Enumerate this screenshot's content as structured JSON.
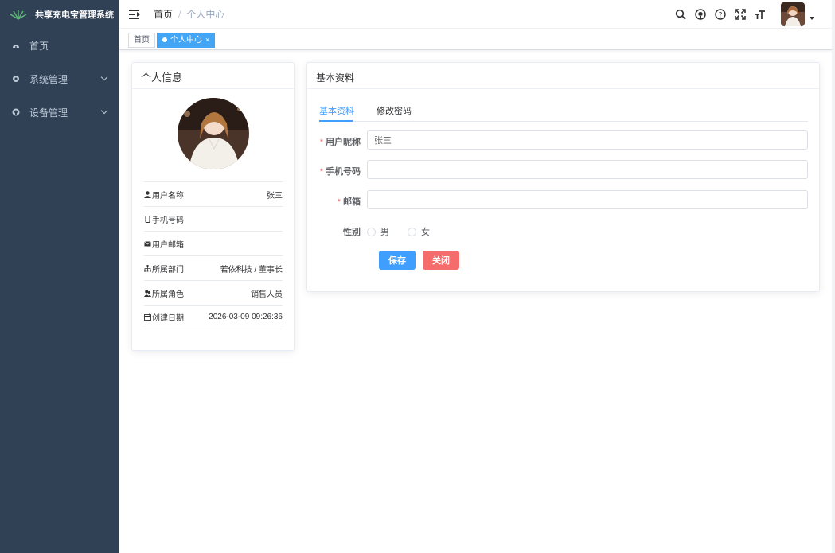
{
  "app": {
    "title": "共享充电宝管理系统",
    "colors": {
      "sidebar_bg": "#304156",
      "accent": "#409eff",
      "danger": "#f56c6c",
      "tag_active": "#409eff"
    }
  },
  "sidebar": {
    "items": [
      {
        "label": "首页",
        "icon": "dashboard-icon",
        "has_arrow": false
      },
      {
        "label": "系统管理",
        "icon": "gear-icon",
        "has_arrow": true
      },
      {
        "label": "设备管理",
        "icon": "github-icon",
        "has_arrow": true
      }
    ]
  },
  "navbar": {
    "breadcrumb": [
      "首页",
      "/",
      "个人中心"
    ],
    "icons": [
      "search-icon",
      "github-icon",
      "help-icon",
      "fullscreen-icon",
      "font-size-icon"
    ]
  },
  "tags": [
    {
      "label": "首页",
      "active": false
    },
    {
      "label": "个人中心",
      "active": true,
      "close": "×"
    }
  ],
  "profile": {
    "title": "个人信息",
    "rows": [
      {
        "icon": "user-icon",
        "label": "用户名称",
        "value": "张三"
      },
      {
        "icon": "phone-icon",
        "label": "手机号码",
        "value": ""
      },
      {
        "icon": "mail-icon",
        "label": "用户邮箱",
        "value": ""
      },
      {
        "icon": "tree-icon",
        "label": "所属部门",
        "value": "若依科技 / 董事长"
      },
      {
        "icon": "peoples-icon",
        "label": "所属角色",
        "value": "销售人员"
      },
      {
        "icon": "date-icon",
        "label": "创建日期",
        "value": "2026-03-09 09:26:36"
      }
    ]
  },
  "basic": {
    "title": "基本资料",
    "tabs": [
      "基本资料",
      "修改密码"
    ],
    "form": {
      "nickname_label": "用户昵称",
      "nickname_value": "张三",
      "phone_label": "手机号码",
      "phone_value": "",
      "email_label": "邮箱",
      "email_value": "",
      "required_mark": "*",
      "gender_label": "性别",
      "gender_options": [
        "男",
        "女"
      ],
      "save": "保存",
      "close": "关闭"
    }
  }
}
